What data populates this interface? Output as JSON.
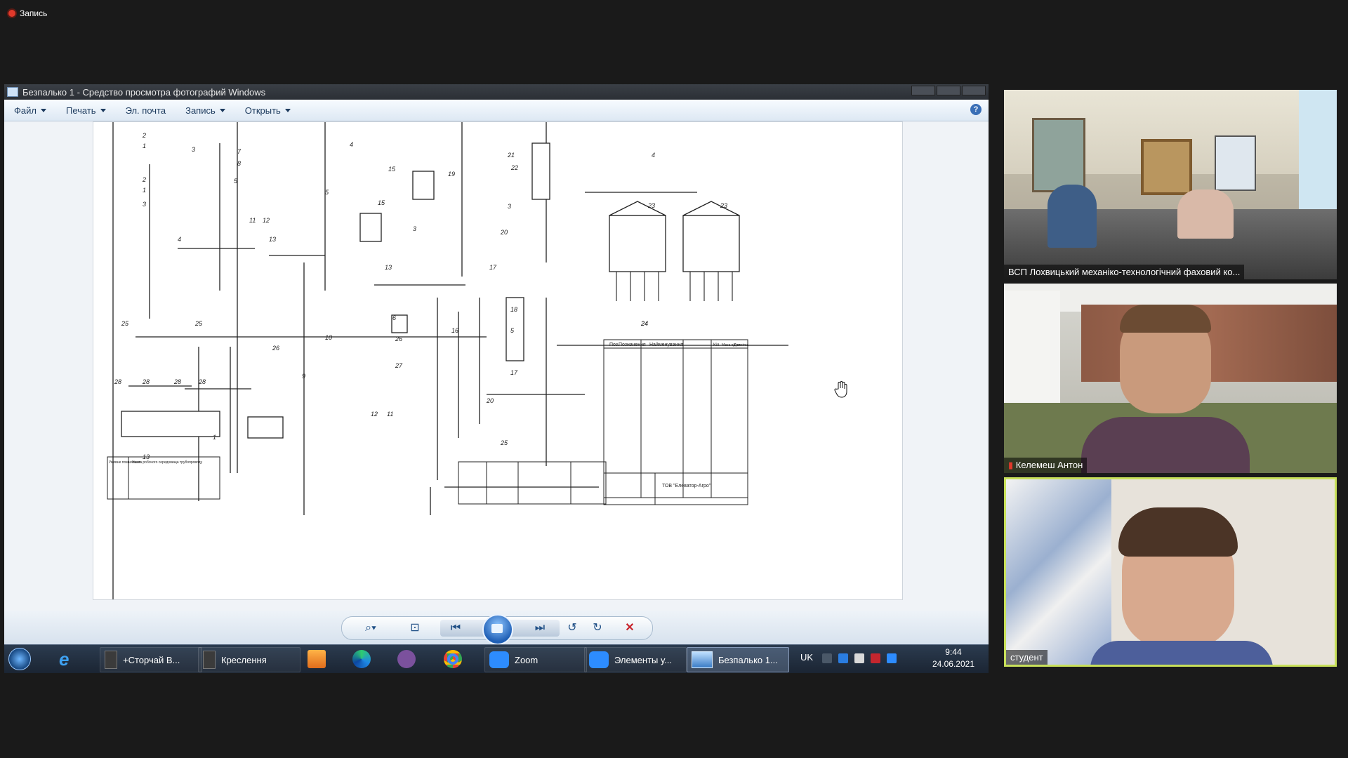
{
  "recording": {
    "label": "Запись"
  },
  "window": {
    "title": "Безпалько 1 - Средство просмотра фотографий Windows",
    "menu": [
      {
        "label": "Файл",
        "has_dropdown": true
      },
      {
        "label": "Печать",
        "has_dropdown": true
      },
      {
        "label": "Эл. почта",
        "has_dropdown": false
      },
      {
        "label": "Запись",
        "has_dropdown": true
      },
      {
        "label": "Открыть",
        "has_dropdown": true
      }
    ],
    "help_label": "?"
  },
  "drawing": {
    "callouts": [
      "2",
      "1",
      "3",
      "2",
      "1",
      "3",
      "4",
      "7",
      "8",
      "5",
      "11",
      "12",
      "13",
      "5",
      "4",
      "15",
      "15",
      "13",
      "3",
      "19",
      "21",
      "22",
      "3",
      "20",
      "4",
      "23",
      "23",
      "24",
      "25",
      "25",
      "28",
      "28",
      "28",
      "28",
      "13",
      "26",
      "10",
      "9",
      "6",
      "26",
      "27",
      "12",
      "11",
      "25",
      "16",
      "17",
      "18",
      "5",
      "17",
      "20",
      "24",
      "1"
    ],
    "table_spec_header": [
      "Поз.",
      "Позначення",
      "Найменування",
      "Кіл.",
      "Маса од. кг",
      "Примітка"
    ],
    "table_small_header": [
      "Умовне позначення",
      "Назва робочого середовища трубопроводу"
    ],
    "stamp_title": "ТОВ \"Елеватор-Агро\""
  },
  "controls": {
    "zoom_icon": "magnifier-icon",
    "fit_icon": "actual-size-icon",
    "prev_icon": "previous-icon",
    "slideshow_icon": "slideshow-icon",
    "next_icon": "next-icon",
    "rotate_ccw_icon": "rotate-left-icon",
    "rotate_cw_icon": "rotate-right-icon",
    "delete_icon": "delete-icon"
  },
  "taskbar": {
    "apps": [
      {
        "label": "+Сторчай В...",
        "icon": "document-icon"
      },
      {
        "label": "Креслення",
        "icon": "document-icon"
      },
      {
        "label": "Zoom",
        "icon": "zoom-icon"
      },
      {
        "label": "Элементы у...",
        "icon": "zoom-icon"
      },
      {
        "label": "Безпалько 1...",
        "icon": "photo-viewer-icon",
        "active": true
      }
    ],
    "language": "UK",
    "time": "9:44",
    "date": "24.06.2021"
  },
  "participants": [
    {
      "name": "ВСП Лохвицький механіко-технологічний фаховий ко..."
    },
    {
      "name": "Келемеш Антон",
      "muted": true
    },
    {
      "name": "студент",
      "active_speaker": true
    }
  ],
  "colors": {
    "active_speaker_border": "#c8e05a",
    "mute_red": "#e0392b",
    "taskbar": "#1f2b3a"
  }
}
